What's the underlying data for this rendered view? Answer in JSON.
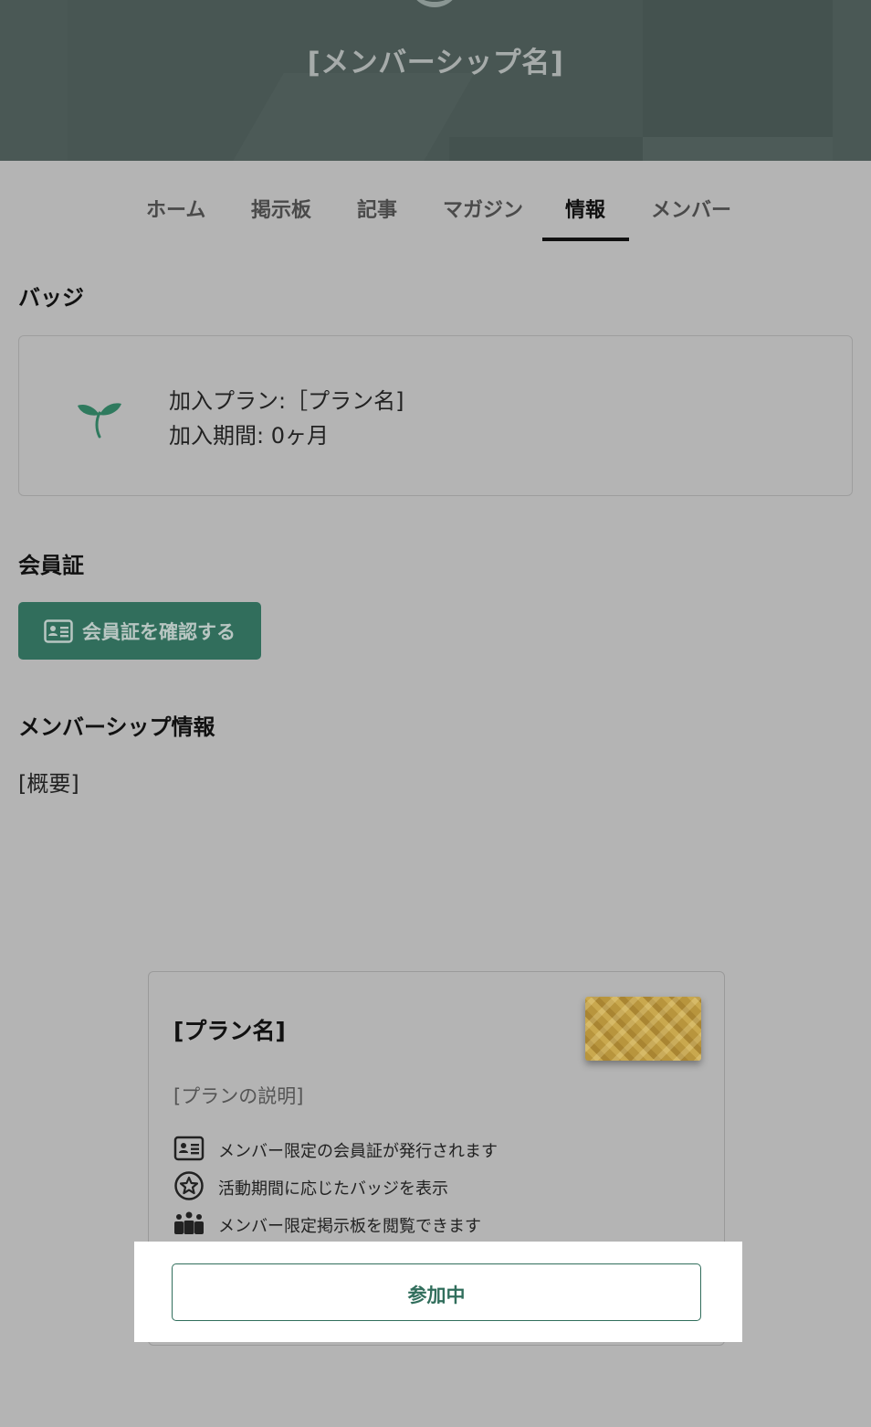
{
  "header": {
    "title": "[メンバーシップ名]"
  },
  "tabs": [
    {
      "label": "ホーム"
    },
    {
      "label": "掲示板"
    },
    {
      "label": "記事"
    },
    {
      "label": "マガジン"
    },
    {
      "label": "情報",
      "active": true
    },
    {
      "label": "メンバー"
    }
  ],
  "badge_section": {
    "title": "バッジ",
    "plan_line": "加入プラン:［プラン名]",
    "period_line": "加入期間:  0ヶ月",
    "icon": "sprout-icon"
  },
  "member_card_section": {
    "title": "会員証",
    "button_label": "会員証を確認する",
    "button_icon": "id-card-icon"
  },
  "membership_info": {
    "title": "メンバーシップ情報",
    "summary": "[概要]"
  },
  "plan_card": {
    "name": "[プラン名]",
    "description": "[プランの説明]",
    "features": [
      {
        "icon": "id-card-icon",
        "text": "メンバー限定の会員証が発行されます"
      },
      {
        "icon": "star-badge-icon",
        "text": "活動期間に応じたバッジを表示"
      },
      {
        "icon": "people-icon",
        "text": "メンバー限定掲示板を閲覧できます"
      }
    ],
    "join_button_label": "参加中"
  },
  "colors": {
    "accent": "#316e5c",
    "header_bg": "#4a5855",
    "overlay_bg": "#b4b4b4"
  }
}
